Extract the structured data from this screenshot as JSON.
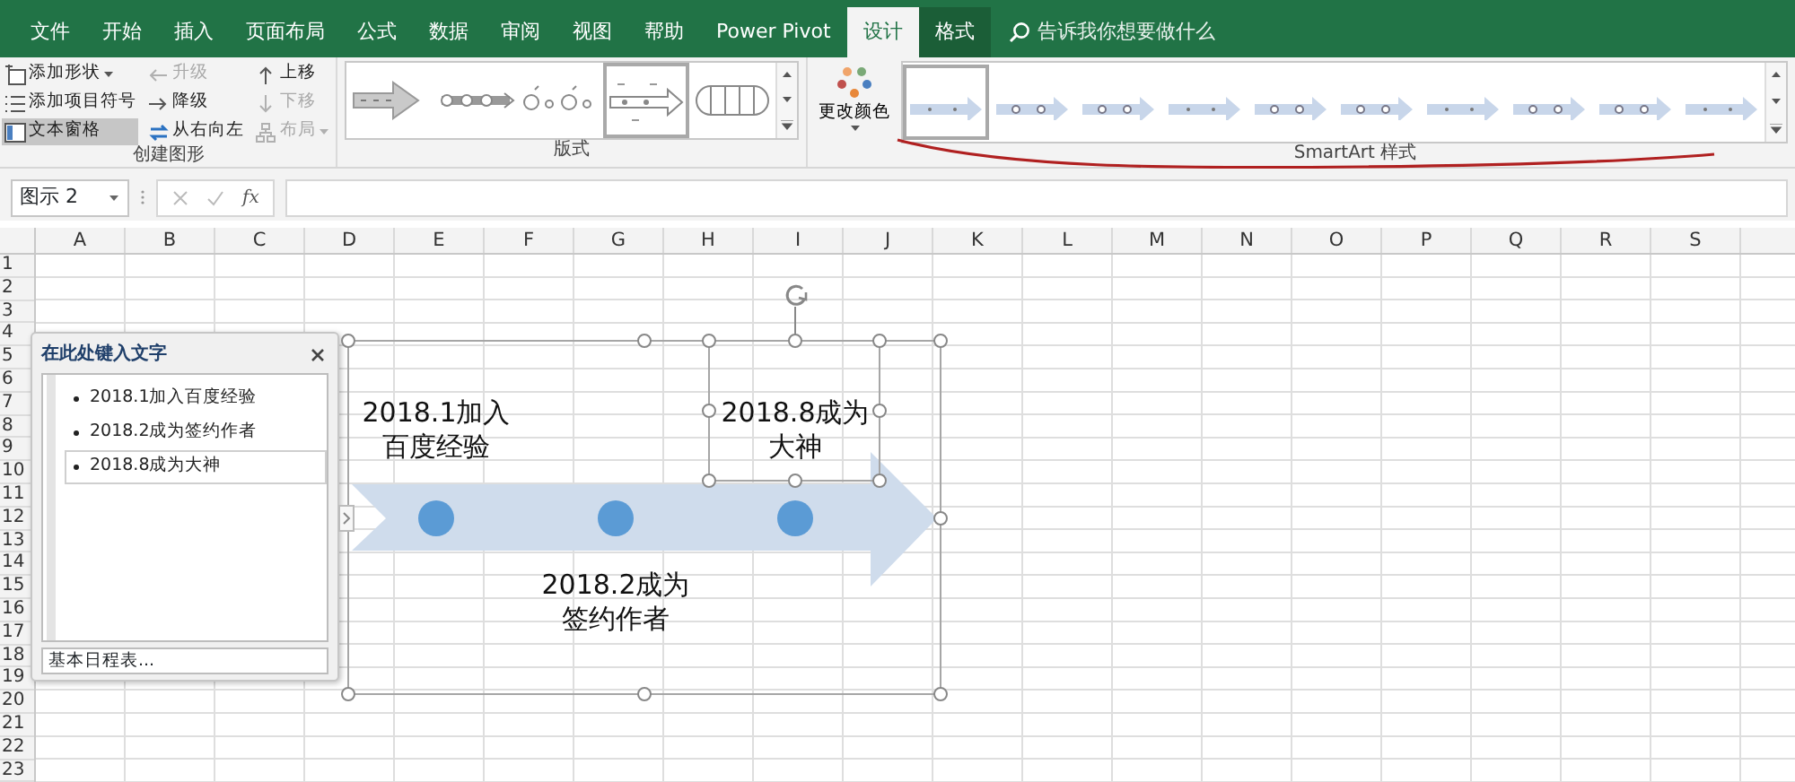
{
  "tabs": [
    {
      "label": "文件",
      "selected": false,
      "contextual": false
    },
    {
      "label": "开始",
      "selected": false,
      "contextual": false
    },
    {
      "label": "插入",
      "selected": false,
      "contextual": false
    },
    {
      "label": "页面布局",
      "selected": false,
      "contextual": false
    },
    {
      "label": "公式",
      "selected": false,
      "contextual": false
    },
    {
      "label": "数据",
      "selected": false,
      "contextual": false
    },
    {
      "label": "审阅",
      "selected": false,
      "contextual": false
    },
    {
      "label": "视图",
      "selected": false,
      "contextual": false
    },
    {
      "label": "帮助",
      "selected": false,
      "contextual": false
    },
    {
      "label": "Power Pivot",
      "selected": false,
      "contextual": false
    },
    {
      "label": "设计",
      "selected": true,
      "contextual": true
    },
    {
      "label": "格式",
      "selected": false,
      "contextual": true
    }
  ],
  "search": {
    "placeholder": "告诉我你想要做什么"
  },
  "ribbon": {
    "create_graphic": {
      "label": "创建图形",
      "columns": [
        [
          {
            "label": "添加形状",
            "disabled": false,
            "dropdown": true,
            "selected": false
          },
          {
            "label": "添加项目符号",
            "disabled": false,
            "dropdown": false,
            "selected": false
          },
          {
            "label": "文本窗格",
            "disabled": false,
            "dropdown": false,
            "selected": true
          }
        ],
        [
          {
            "label": "升级",
            "disabled": true,
            "dropdown": false,
            "selected": false
          },
          {
            "label": "降级",
            "disabled": false,
            "dropdown": false,
            "selected": false
          },
          {
            "label": "从右向左",
            "disabled": false,
            "dropdown": false,
            "selected": false
          }
        ],
        [
          {
            "label": "上移",
            "disabled": false,
            "dropdown": false,
            "selected": false
          },
          {
            "label": "下移",
            "disabled": true,
            "dropdown": false,
            "selected": false
          },
          {
            "label": "布局",
            "disabled": true,
            "dropdown": true,
            "selected": false
          }
        ]
      ]
    },
    "layouts": {
      "label": "版式",
      "items": [
        {
          "selected": false
        },
        {
          "selected": false
        },
        {
          "selected": false
        },
        {
          "selected": true
        },
        {
          "selected": false
        }
      ]
    },
    "change_colors": {
      "label": "更改颜色"
    },
    "styles": {
      "label": "SmartArt 样式",
      "items": [
        {
          "selected": true
        },
        {
          "selected": false
        },
        {
          "selected": false
        },
        {
          "selected": false
        },
        {
          "selected": false
        },
        {
          "selected": false
        },
        {
          "selected": false
        },
        {
          "selected": false
        },
        {
          "selected": false
        },
        {
          "selected": false
        }
      ]
    }
  },
  "formula_bar": {
    "name_box": "图示 2",
    "function_button": "fx"
  },
  "columns": [
    "A",
    "B",
    "C",
    "D",
    "E",
    "F",
    "G",
    "H",
    "I",
    "J",
    "K",
    "L",
    "M",
    "N",
    "O",
    "P",
    "Q",
    "R",
    "S"
  ],
  "rows": [
    "1",
    "2",
    "3",
    "4",
    "5",
    "6",
    "7",
    "8",
    "9",
    "10",
    "11",
    "12",
    "13",
    "14",
    "15",
    "16",
    "17",
    "18",
    "19",
    "20",
    "21",
    "22",
    "23"
  ],
  "text_pane": {
    "title": "在此处键入文字",
    "items": [
      {
        "text": "2018.1加入百度经验",
        "selected": false
      },
      {
        "text": "2018.2成为签约作者",
        "selected": false
      },
      {
        "text": "2018.8成为大神",
        "selected": true
      }
    ],
    "footer": "基本日程表..."
  },
  "smartart": {
    "items": [
      {
        "lines": [
          "2018.1加入",
          "百度经验"
        ],
        "selected": false
      },
      {
        "lines": [
          "2018.2成为",
          "签约作者"
        ],
        "selected": false
      },
      {
        "lines": [
          "2018.8成为",
          "大神"
        ],
        "selected": true
      }
    ]
  }
}
